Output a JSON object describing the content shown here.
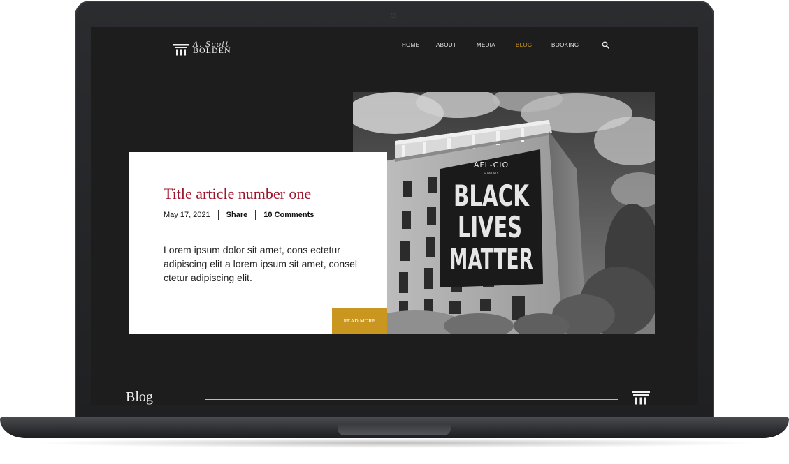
{
  "header": {
    "logo": {
      "script_text": "A. Scott",
      "name_text": "BOLDEN",
      "icon": "column-pillar-icon"
    },
    "nav": [
      {
        "label": "HOME",
        "active": false
      },
      {
        "label": "ABOUT",
        "active": false
      },
      {
        "label": "MEDIA",
        "active": false
      },
      {
        "label": "BLOG",
        "active": true
      },
      {
        "label": "BOOKING",
        "active": false
      }
    ],
    "search_icon": "search-icon"
  },
  "featured_article": {
    "title": "Title article number one",
    "date": "May 17, 2021",
    "share_label": "Share",
    "comments_label": "10 Comments",
    "excerpt": "Lorem ipsum dolor sit amet, cons ectetur adipiscing elit a lorem ipsum sit amet, consel ctetur adipiscing elit.",
    "read_more_label": "READ MORE",
    "image": {
      "banner_top": "AFL-CIO",
      "banner_small": "SUPPORTS",
      "banner_lines": [
        "BLACK",
        "LIVES",
        "MATTER"
      ]
    }
  },
  "blog_section": {
    "heading": "Blog",
    "icon": "column-pillar-icon"
  },
  "colors": {
    "accent_gold": "#c9971f",
    "title_red": "#a0142b",
    "screen_bg": "#1d1d1d"
  }
}
